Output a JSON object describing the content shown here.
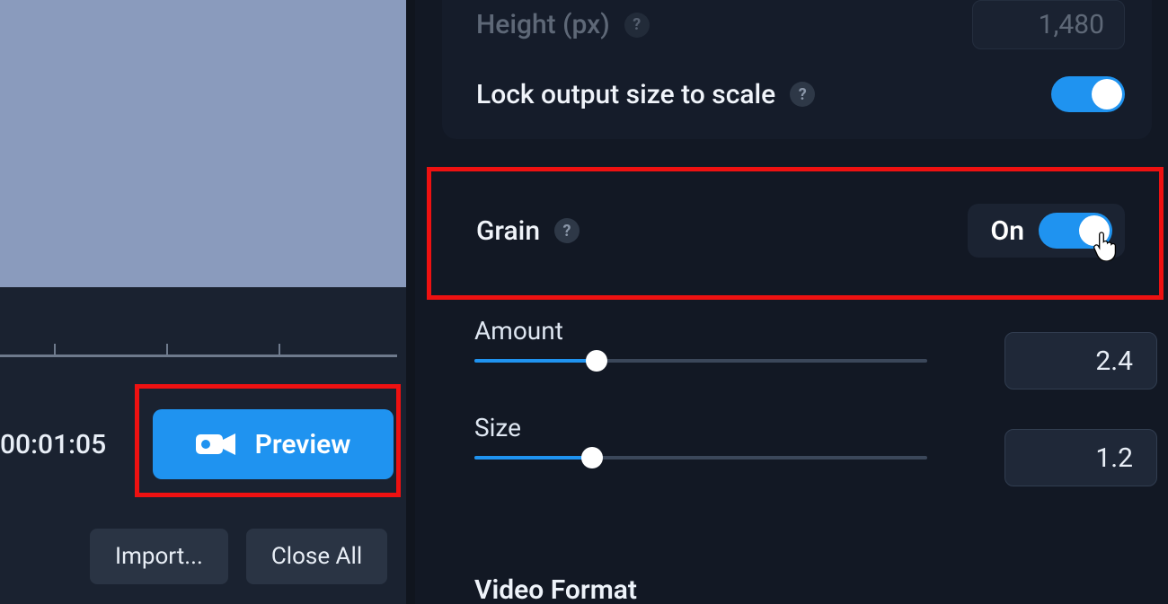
{
  "left": {
    "timecode": "00:01:05",
    "preview_label": "Preview",
    "import_label": "Import...",
    "close_all_label": "Close All"
  },
  "settings": {
    "height_label": "Height (px)",
    "height_value": "1,480",
    "lock_label": "Lock output size to scale",
    "lock_on": true,
    "grain": {
      "label": "Grain",
      "state_label": "On",
      "on": true,
      "amount_label": "Amount",
      "amount_value": "2.4",
      "amount_fill_pct": 27,
      "size_label": "Size",
      "size_value": "1.2",
      "size_fill_pct": 26
    },
    "video_format_label": "Video Format"
  },
  "colors": {
    "accent": "#1f93f0",
    "highlight": "#ee1111"
  }
}
